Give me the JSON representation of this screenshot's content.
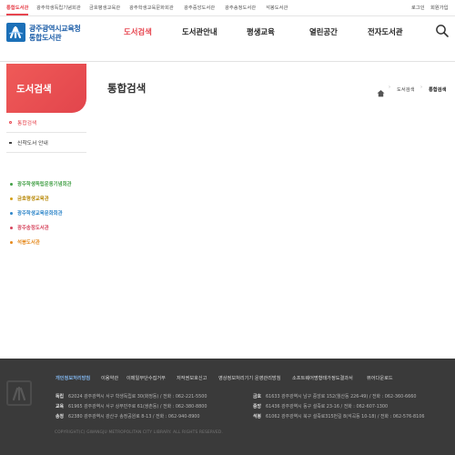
{
  "top_bar": {
    "site_tabs": [
      {
        "label": "통합도서관",
        "active": true
      },
      {
        "label": "광주학생독립기념회관",
        "active": false
      },
      {
        "label": "금호평생교육관",
        "active": false
      },
      {
        "label": "광주학생교육문화회관",
        "active": false
      },
      {
        "label": "광주중앙도서관",
        "active": false
      },
      {
        "label": "광주송정도서관",
        "active": false
      },
      {
        "label": "석봉도서관",
        "active": false
      }
    ],
    "utility_links": [
      "로그인",
      "회원가입"
    ]
  },
  "header": {
    "logo_line1": "광주광역시교육청",
    "logo_line2": "통합도서관",
    "nav": [
      {
        "label": "도서검색",
        "active": true
      },
      {
        "label": "도서관안내",
        "active": false
      },
      {
        "label": "평생교육",
        "active": false
      },
      {
        "label": "열린공간",
        "active": false
      },
      {
        "label": "전자도서관",
        "active": false
      }
    ],
    "search_icon": "search-icon"
  },
  "sidebar": {
    "title": "도서검색",
    "items": [
      {
        "label": "통합검색",
        "active": true
      },
      {
        "label": "신착도서 안내",
        "active": false
      }
    ],
    "libraries": [
      {
        "label": "광주학생독립운동기념회관",
        "color": "#43a047"
      },
      {
        "label": "금호평생교육관",
        "color": "#d4a017"
      },
      {
        "label": "광주학생교육문화회관",
        "color": "#2f86c9"
      },
      {
        "label": "광주송정도서관",
        "color": "#d6455d"
      },
      {
        "label": "석봉도서관",
        "color": "#e58a1f"
      }
    ]
  },
  "content": {
    "title": "통합검색",
    "breadcrumb": [
      "도서검색",
      "통합검색"
    ]
  },
  "footer": {
    "links": [
      {
        "label": "개인정보처리방침",
        "highlight": true
      },
      {
        "label": "이용약관",
        "highlight": false
      },
      {
        "label": "이메일무단수집거부",
        "highlight": false
      },
      {
        "label": "저작권보호신고",
        "highlight": false
      },
      {
        "label": "영상정보처리기기 운영관리방침",
        "highlight": false
      },
      {
        "label": "소프트웨어명형태가정도결과서",
        "highlight": false
      },
      {
        "label": "뷰어다운로드",
        "highlight": false
      }
    ],
    "addresses": [
      {
        "name": "독립",
        "text": "62024 광주광역시 서구 학생독립로 30(화정동) / 전화 : 062-221-5500"
      },
      {
        "name": "금호",
        "text": "61633 광주광역시 남구 중앙로 152(월산동 226-49) / 전화 : 062-360-6660"
      },
      {
        "name": "교육",
        "text": "61965 광주광역시 서구 상무민주로 61(쌍촌동) / 전화 : 062-380-8800"
      },
      {
        "name": "중앙",
        "text": "61436 광주광역시 동구 설죽로 23-16 / 전화 : 062-607-1300"
      },
      {
        "name": "송정",
        "text": "62380 광주광역시 광산구 송정공원로 8-13 / 전화 : 062-940-8900"
      },
      {
        "name": "석봉",
        "text": "61062 광주광역시 북구 설죽로315번길 8(석곡동 10-18) / 전화 : 062-576-8106"
      }
    ],
    "copyright": "COPYRIGHT(C) GWANGJU METROPOLITAN CITY LIBRARY. ALL RIGHTS RESERVED."
  },
  "colors": {
    "accent": "#e7454f",
    "logo_blue": "#1c70b8",
    "footer_bg": "#3a3a3a",
    "footer_link_highlight": "#7fb1e6"
  }
}
